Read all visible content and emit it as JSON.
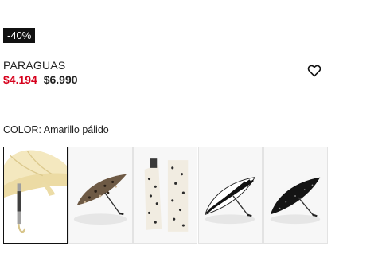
{
  "product": {
    "discount_badge": "-40%",
    "name": "PARAGUAS",
    "price_sale": "$4.194",
    "price_original": "$6.990"
  },
  "color": {
    "label": "COLOR:",
    "selected": "Amarillo pálido"
  },
  "wishlist_icon": "heart-outline-icon",
  "colors": {
    "sale": "#d6001c",
    "badge_bg": "#111111"
  },
  "swatches": [
    {
      "name": "Amarillo pálido",
      "selected": true
    },
    {
      "name": "Leopardo",
      "selected": false
    },
    {
      "name": "Crema con puntos",
      "selected": false
    },
    {
      "name": "Rayas negras",
      "selected": false
    },
    {
      "name": "Negro con puntos",
      "selected": false
    }
  ]
}
